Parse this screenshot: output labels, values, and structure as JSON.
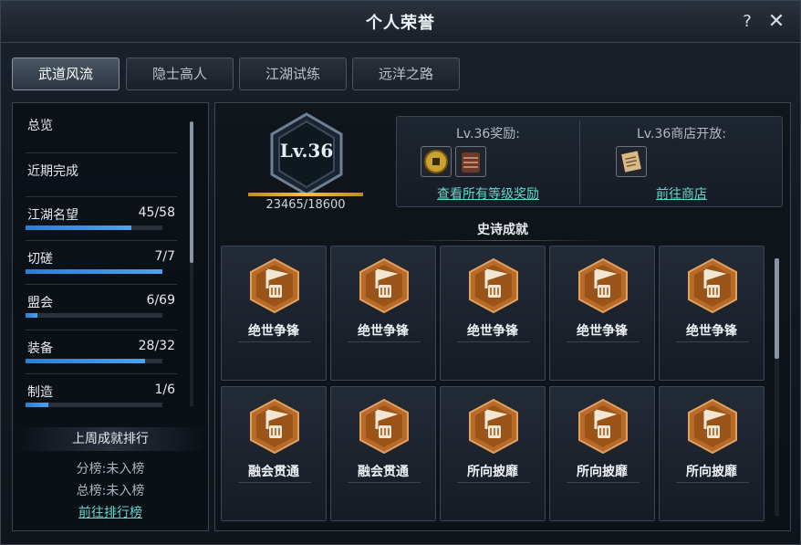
{
  "window": {
    "title": "个人荣誉"
  },
  "controls": {
    "help": "?",
    "close": "✕"
  },
  "tabs": [
    {
      "label": "武道风流",
      "active": true
    },
    {
      "label": "隐士高人",
      "active": false
    },
    {
      "label": "江湖试练",
      "active": false
    },
    {
      "label": "远洋之路",
      "active": false
    }
  ],
  "sidebar": {
    "items": [
      {
        "label": "总览",
        "count": "",
        "progress": null
      },
      {
        "label": "近期完成",
        "count": "",
        "progress": null
      },
      {
        "label": "江湖名望",
        "count": "45/58",
        "progress": 0.776
      },
      {
        "label": "切磋",
        "count": "7/7",
        "progress": 1.0
      },
      {
        "label": "盟会",
        "count": "6/69",
        "progress": 0.087
      },
      {
        "label": "装备",
        "count": "28/32",
        "progress": 0.875
      },
      {
        "label": "制造",
        "count": "1/6",
        "progress": 0.167
      }
    ],
    "ranking": {
      "header": "上周成就排行",
      "sub_rank": "分榜:未入榜",
      "total_rank": "总榜:未入榜",
      "link": "前往排行榜"
    }
  },
  "level": {
    "label": "Lv.36",
    "xp": "23465/18600",
    "xp_progress": 1.0
  },
  "rewards": {
    "reward_title": "Lv.36奖励:",
    "reward_link": "查看所有等级奖励",
    "reward_items": [
      "gold-coin-icon",
      "leather-armor-icon"
    ],
    "shop_title": "Lv.36商店开放:",
    "shop_link": "前往商店",
    "shop_items": [
      "scroll-book-icon"
    ]
  },
  "achievements": {
    "section_title": "史诗成就",
    "items": [
      {
        "name": "绝世争锋",
        "icon": "fist-banner-icon"
      },
      {
        "name": "绝世争锋",
        "icon": "fist-banner-icon"
      },
      {
        "name": "绝世争锋",
        "icon": "fist-banner-icon"
      },
      {
        "name": "绝世争锋",
        "icon": "fist-banner-icon"
      },
      {
        "name": "绝世争锋",
        "icon": "fist-banner-icon"
      },
      {
        "name": "融会贯通",
        "icon": "fist-banner-icon"
      },
      {
        "name": "融会贯通",
        "icon": "fist-banner-icon"
      },
      {
        "name": "所向披靡",
        "icon": "fist-banner-icon"
      },
      {
        "name": "所向披靡",
        "icon": "fist-banner-icon"
      },
      {
        "name": "所向披靡",
        "icon": "fist-banner-icon"
      }
    ]
  },
  "colors": {
    "accent_link": "#63d6c8",
    "progress_blue": "#2a7fd1",
    "xp_gold": "#f5c14a",
    "badge_orange": "#b86a28"
  }
}
